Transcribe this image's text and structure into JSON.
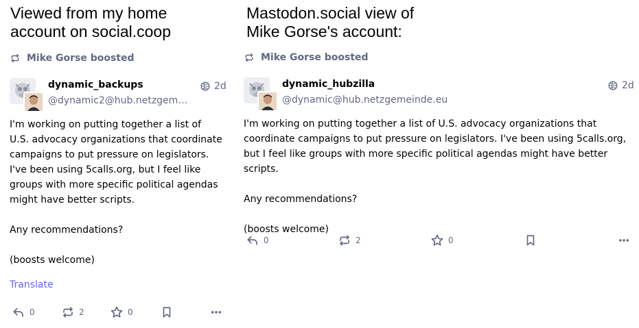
{
  "left": {
    "caption": {
      "line1": "Viewed from my home",
      "line2": "account on social.coop"
    },
    "boosted_label": "Mike Gorse boosted",
    "display_name": "dynamic_backups",
    "account": "@dynamic2@hub.netzgemei…",
    "time": "2d",
    "content": {
      "p1": "I'm working on putting together a list of U.S. advocacy organizations that coordinate campaigns to put pressure on legislators.  I've been using 5calls.org, but I feel like groups with more specific political agendas might have better scripts.",
      "p2": "Any recommendations?",
      "p3": "(boosts welcome)"
    },
    "translate": "Translate",
    "replies": "0",
    "boosts": "2",
    "favourites": "0"
  },
  "right": {
    "caption": {
      "line1": "Mastodon.social view of",
      "line2": "Mike Gorse's account:"
    },
    "boosted_label": "Mike Gorse boosted",
    "display_name": "dynamic_hubzilla",
    "account": "@dynamic@hub.netzgemeinde.eu",
    "time": "2d",
    "content": {
      "p1": "I'm working on putting together a list of U.S. advocacy organizations that coordinate campaigns to put pressure on legislators.  I've been using 5calls.org, but I feel like groups with more specific political agendas might have better scripts.",
      "p2": "Any recommendations?",
      "p3": "(boosts welcome)"
    },
    "replies": "0",
    "boosts": "2",
    "favourites": "0"
  },
  "colors": {
    "accent": "#6364ff",
    "muted": "#606984",
    "text": "#000000"
  },
  "icons": [
    "boost-icon",
    "globe-icon",
    "reply-icon",
    "star-icon",
    "bookmark-icon",
    "more-icon"
  ]
}
